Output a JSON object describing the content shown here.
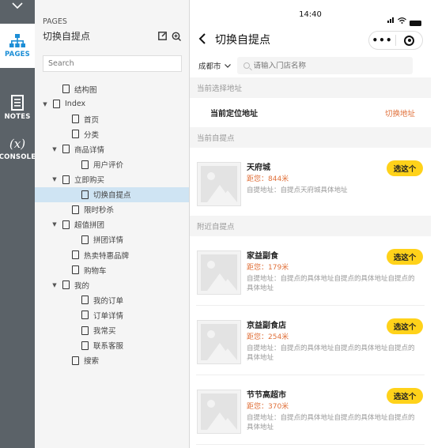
{
  "rail": {
    "items": [
      {
        "label": "PAGES"
      },
      {
        "label": "NOTES"
      },
      {
        "label": "CONSOLE"
      }
    ]
  },
  "pages_panel": {
    "caption": "PAGES",
    "title": "切换自提点",
    "search_placeholder": "Search",
    "tree": [
      {
        "label": "结构图",
        "depth": 1,
        "caret": ""
      },
      {
        "label": "Index",
        "depth": 0,
        "caret": "▼"
      },
      {
        "label": "首页",
        "depth": 2,
        "caret": ""
      },
      {
        "label": "分类",
        "depth": 2,
        "caret": ""
      },
      {
        "label": "商品详情",
        "depth": 1,
        "caret": "▼"
      },
      {
        "label": "用户评价",
        "depth": 3,
        "caret": ""
      },
      {
        "label": "立即购买",
        "depth": 1,
        "caret": "▼"
      },
      {
        "label": "切换自提点",
        "depth": 3,
        "caret": "",
        "active": true
      },
      {
        "label": "限时秒杀",
        "depth": 2,
        "caret": ""
      },
      {
        "label": "超值拼团",
        "depth": 1,
        "caret": "▼"
      },
      {
        "label": "拼团详情",
        "depth": 3,
        "caret": ""
      },
      {
        "label": "热卖特惠品牌",
        "depth": 2,
        "caret": ""
      },
      {
        "label": "购物车",
        "depth": 2,
        "caret": ""
      },
      {
        "label": "我的",
        "depth": 1,
        "caret": "▼"
      },
      {
        "label": "我的订单",
        "depth": 3,
        "caret": ""
      },
      {
        "label": "订单详情",
        "depth": 3,
        "caret": ""
      },
      {
        "label": "我常买",
        "depth": 3,
        "caret": ""
      },
      {
        "label": "联系客服",
        "depth": 3,
        "caret": ""
      },
      {
        "label": "搜索",
        "depth": 2,
        "caret": ""
      }
    ]
  },
  "phone": {
    "time": "14:40",
    "nav_title": "切换自提点",
    "capsule_more": "•••",
    "city": "成都市",
    "store_search_placeholder": "请输入门店名称",
    "section_current_address": "当前选择地址",
    "current_location_label": "当前定位地址",
    "switch_address": "切换地址",
    "section_current_pickup": "当前自提点",
    "current_store": {
      "name": "天府城",
      "distance": "距您：844米",
      "address": "自提地址：自提点天府城具体地址",
      "button": "选这个"
    },
    "section_nearby": "附近自提点",
    "nearby_stores": [
      {
        "name": "家益副食",
        "distance": "距您：179米",
        "address": "自提地址：自提点的具体地址自提点的具体地址自提点的具体地址",
        "button": "选这个"
      },
      {
        "name": "京益副食店",
        "distance": "距您：254米",
        "address": "自提地址：自提点的具体地址自提点的具体地址自提点的具体地址",
        "button": "选这个"
      },
      {
        "name": "节节高超市",
        "distance": "距您：370米",
        "address": "自提地址：自提点的具体地址自提点的具体地址自提点的具体地址",
        "button": "选这个"
      }
    ],
    "colors": {
      "accent": "#ffd21a",
      "orange": "#e0703a"
    }
  }
}
